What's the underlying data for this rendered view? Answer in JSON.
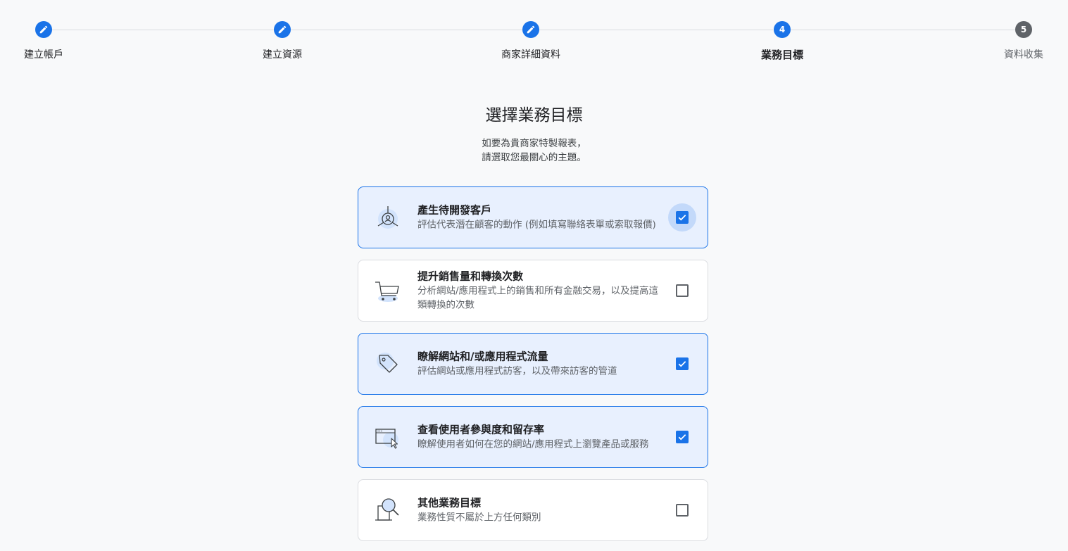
{
  "stepper": {
    "steps": [
      {
        "label": "建立帳戶",
        "state": "done",
        "icon": "pencil-icon",
        "number": ""
      },
      {
        "label": "建立資源",
        "state": "done",
        "icon": "pencil-icon",
        "number": ""
      },
      {
        "label": "商家詳細資料",
        "state": "done",
        "icon": "pencil-icon",
        "number": ""
      },
      {
        "label": "業務目標",
        "state": "active",
        "icon": "",
        "number": "4"
      },
      {
        "label": "資料收集",
        "state": "pending",
        "icon": "",
        "number": "5"
      }
    ]
  },
  "page": {
    "title": "選擇業務目標",
    "subtitle_line1": "如要為貴商家特製報表，",
    "subtitle_line2": "請選取您最關心的主題。"
  },
  "options": [
    {
      "title": "產生待開發客戶",
      "desc": "評估代表潛在顧客的動作 (例如填寫聯絡表單或索取報價)",
      "checked": true,
      "icon": "leads-target-icon"
    },
    {
      "title": "提升銷售量和轉換次數",
      "desc": "分析網站/應用程式上的銷售和所有金融交易，以及提高這類轉換的次數",
      "checked": false,
      "icon": "shopping-cart-icon"
    },
    {
      "title": "瞭解網站和/或應用程式流量",
      "desc": "評估網站或應用程式訪客，以及帶來訪客的管道",
      "checked": true,
      "icon": "tag-icon"
    },
    {
      "title": "查看使用者參與度和留存率",
      "desc": "瞭解使用者如何在您的網站/應用程式上瀏覽產品或服務",
      "checked": true,
      "icon": "browser-cursor-icon"
    },
    {
      "title": "其他業務目標",
      "desc": "業務性質不屬於上方任何類別",
      "checked": false,
      "icon": "magnifier-document-icon"
    }
  ],
  "colors": {
    "accent": "#1a73e8",
    "selected_bg": "#e8f0fe",
    "page_bg": "#f8f9fa"
  }
}
